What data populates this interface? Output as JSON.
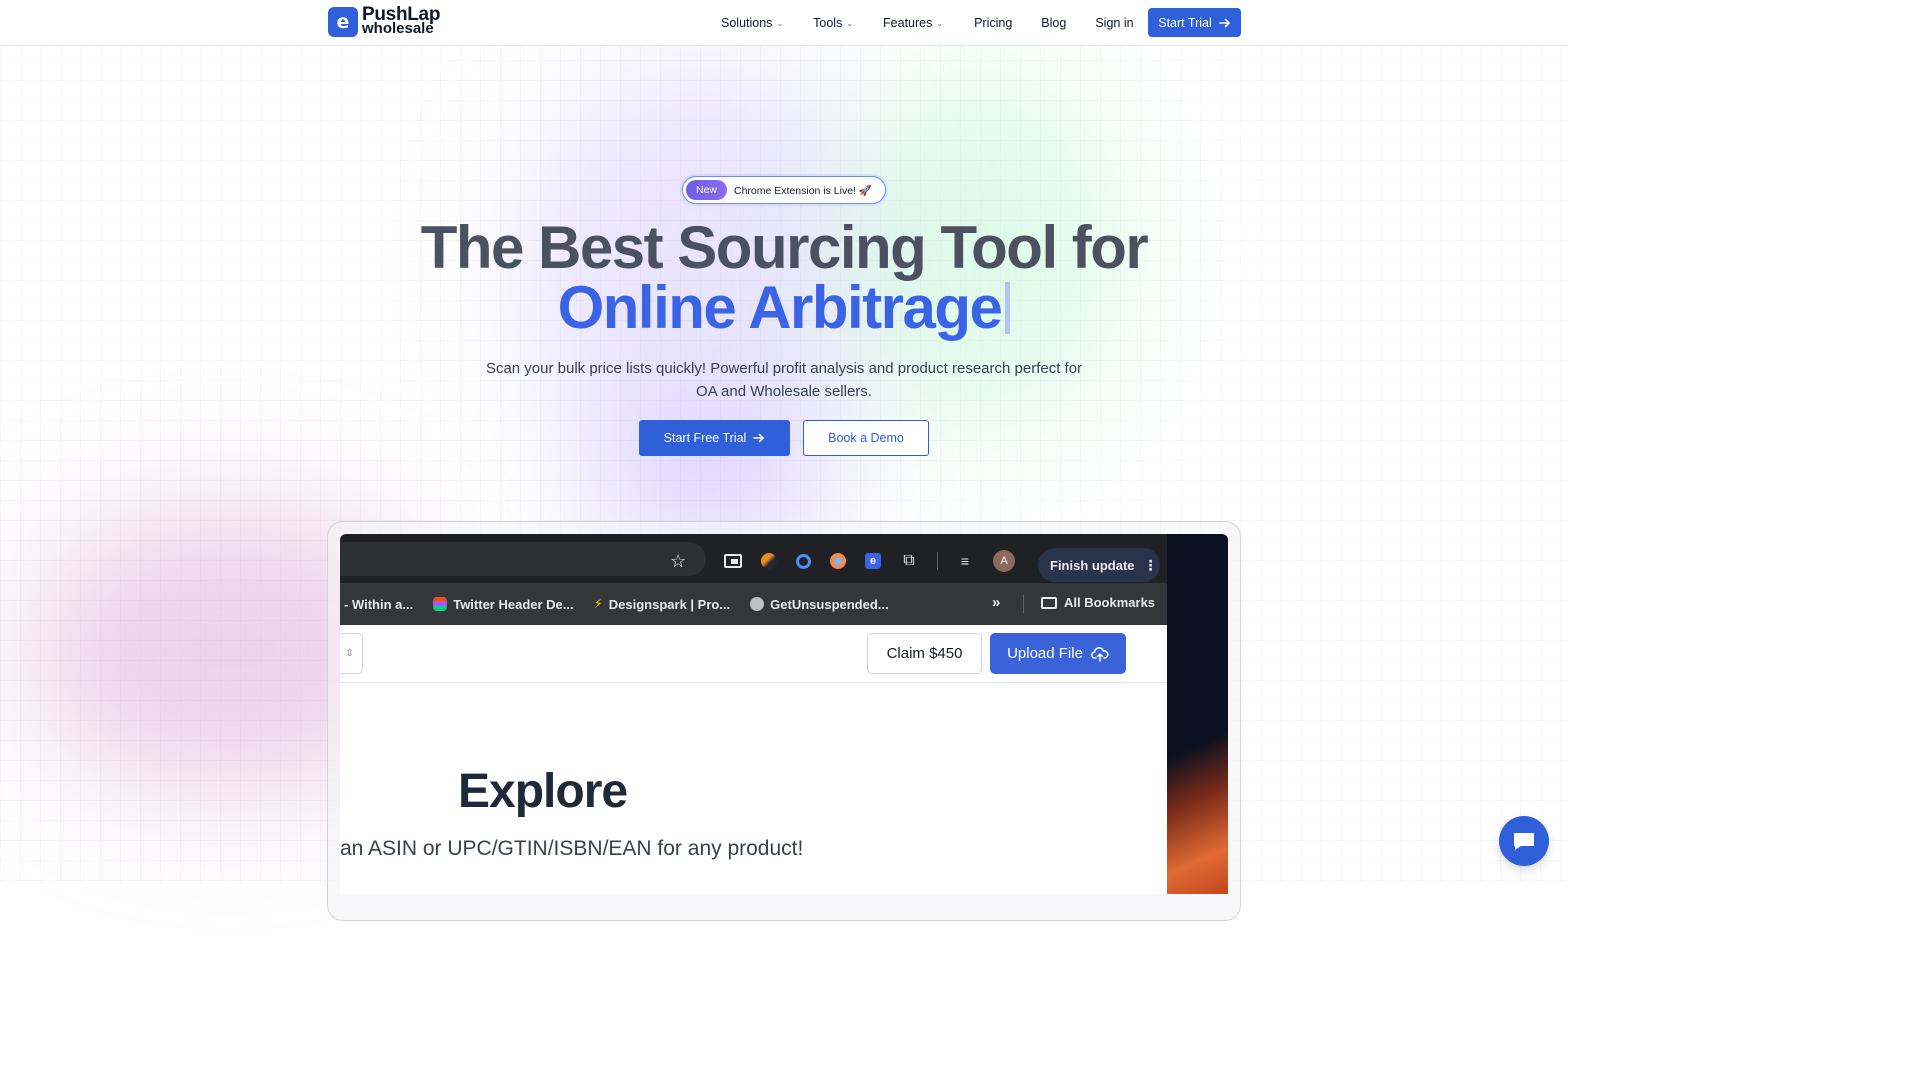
{
  "brand": {
    "logo_glyph": "e",
    "name_line1": "PushLap",
    "name_line2": "wholesale",
    "accent_color": "#2f5fd9"
  },
  "nav": {
    "items": [
      {
        "label": "Solutions",
        "has_dropdown": true
      },
      {
        "label": "Tools",
        "has_dropdown": true
      },
      {
        "label": "Features",
        "has_dropdown": true
      },
      {
        "label": "Pricing",
        "has_dropdown": false
      },
      {
        "label": "Blog",
        "has_dropdown": false
      },
      {
        "label": "Sign in",
        "has_dropdown": false
      }
    ],
    "cta_label": "Start Trial"
  },
  "hero": {
    "badge_tag": "New",
    "badge_text": "Chrome Extension is Live! 🚀",
    "title_line1": "The Best Sourcing Tool for",
    "title_line2": "Online Arbitrage",
    "subtitle": "Scan your bulk price lists quickly! Powerful profit analysis and product research perfect for OA and Wholesale sellers.",
    "primary_cta": "Start Free Trial",
    "secondary_cta": "Book a Demo"
  },
  "preview": {
    "browser": {
      "finish_update_label": "Finish update",
      "avatar_letter": "A",
      "bookmarks": [
        {
          "label": "- Within a...",
          "icon": "none"
        },
        {
          "label": "Twitter Header De...",
          "icon": "figma-icon"
        },
        {
          "label": "Designspark | Pro...",
          "icon": "bolt-icon"
        },
        {
          "label": "GetUnsuspended...",
          "icon": "globe-icon"
        }
      ],
      "all_bookmarks_label": "All Bookmarks"
    },
    "app": {
      "claim_label": "Claim $450",
      "upload_label": "Upload File",
      "explore_title": "Explore",
      "explore_subtitle": "an ASIN or UPC/GTIN/ISBN/EAN for any product!"
    }
  }
}
